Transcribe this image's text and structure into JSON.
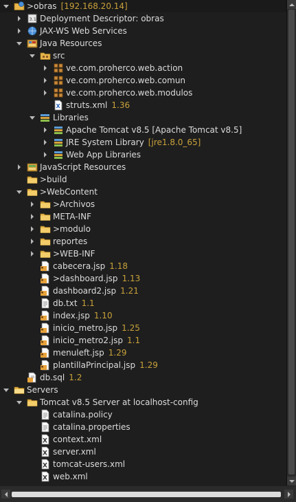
{
  "colors": {
    "background": "#1e1e1e",
    "text": "#dcdcdc",
    "decoration": "#c8a13a"
  },
  "tree": [
    {
      "name": "obras-project",
      "depth": 0,
      "twisty": "expanded",
      "icon": "web-project-icon",
      "label": ">obras",
      "extra": "[192.168.20.14]",
      "extra_kind": "ip",
      "selected": true
    },
    {
      "name": "deployment-descriptor",
      "depth": 1,
      "twisty": "collapsed",
      "icon": "deployment-descriptor-icon",
      "label": "Deployment Descriptor: obras"
    },
    {
      "name": "jax-ws-web-services",
      "depth": 1,
      "twisty": "collapsed",
      "icon": "web-services-icon",
      "label": "JAX-WS Web Services"
    },
    {
      "name": "java-resources",
      "depth": 1,
      "twisty": "expanded",
      "icon": "java-resources-icon",
      "label": "Java Resources"
    },
    {
      "name": "src",
      "depth": 2,
      "twisty": "expanded",
      "icon": "source-folder-icon",
      "label": "src"
    },
    {
      "name": "package-web-action",
      "depth": 3,
      "twisty": "collapsed",
      "icon": "package-icon",
      "label": "ve.com.proherco.web.action"
    },
    {
      "name": "package-web-comun",
      "depth": 3,
      "twisty": "collapsed",
      "icon": "package-icon",
      "label": "ve.com.proherco.web.comun"
    },
    {
      "name": "package-web-modulos",
      "depth": 3,
      "twisty": "collapsed",
      "icon": "package-icon",
      "label": "ve.com.proherco.web.modulos"
    },
    {
      "name": "struts-xml",
      "depth": 3,
      "twisty": "none",
      "icon": "struts-file-icon",
      "label": "struts.xml",
      "extra": "1.36",
      "extra_kind": "ver"
    },
    {
      "name": "libraries",
      "depth": 2,
      "twisty": "expanded",
      "icon": "libraries-icon",
      "label": "Libraries"
    },
    {
      "name": "apache-tomcat-lib",
      "depth": 3,
      "twisty": "collapsed",
      "icon": "library-icon",
      "label": "Apache Tomcat v8.5 [Apache Tomcat v8.5]"
    },
    {
      "name": "jre-system-library",
      "depth": 3,
      "twisty": "collapsed",
      "icon": "library-icon",
      "label": "JRE System Library",
      "extra": "[jre1.8.0_65]",
      "extra_kind": "ver"
    },
    {
      "name": "web-app-libraries",
      "depth": 3,
      "twisty": "collapsed",
      "icon": "library-icon",
      "label": "Web App Libraries"
    },
    {
      "name": "javascript-resources",
      "depth": 1,
      "twisty": "collapsed",
      "icon": "javascript-resources-icon",
      "label": "JavaScript Resources"
    },
    {
      "name": "build-folder",
      "depth": 1,
      "twisty": "none",
      "icon": "folder-icon",
      "label": ">build"
    },
    {
      "name": "webcontent-folder",
      "depth": 1,
      "twisty": "expanded",
      "icon": "folder-icon",
      "label": ">WebContent"
    },
    {
      "name": "archivos-folder",
      "depth": 2,
      "twisty": "collapsed",
      "icon": "folder-icon",
      "label": ">Archivos"
    },
    {
      "name": "meta-inf-folder",
      "depth": 2,
      "twisty": "collapsed",
      "icon": "folder-icon",
      "label": "META-INF"
    },
    {
      "name": "modulo-folder",
      "depth": 2,
      "twisty": "collapsed",
      "icon": "folder-icon",
      "label": ">modulo"
    },
    {
      "name": "reportes-folder",
      "depth": 2,
      "twisty": "collapsed",
      "icon": "folder-icon",
      "label": "reportes"
    },
    {
      "name": "web-inf-folder",
      "depth": 2,
      "twisty": "collapsed",
      "icon": "folder-icon",
      "label": ">WEB-INF"
    },
    {
      "name": "cabecera-jsp",
      "depth": 2,
      "twisty": "none",
      "icon": "jsp-file-icon",
      "label": "cabecera.jsp",
      "extra": "1.18",
      "extra_kind": "ver"
    },
    {
      "name": "dashboard-jsp",
      "depth": 2,
      "twisty": "none",
      "icon": "jsp-file-icon",
      "label": ">dashboard.jsp",
      "extra": "1.13",
      "extra_kind": "ver"
    },
    {
      "name": "dashboard2-jsp",
      "depth": 2,
      "twisty": "none",
      "icon": "jsp-file-icon",
      "label": "dashboard2.jsp",
      "extra": "1.21",
      "extra_kind": "ver"
    },
    {
      "name": "db-txt",
      "depth": 2,
      "twisty": "none",
      "icon": "text-file-icon",
      "label": "db.txt",
      "extra": "1.1",
      "extra_kind": "ver"
    },
    {
      "name": "index-jsp",
      "depth": 2,
      "twisty": "none",
      "icon": "jsp-file-icon",
      "label": "index.jsp",
      "extra": "1.10",
      "extra_kind": "ver"
    },
    {
      "name": "inicio-metro-jsp",
      "depth": 2,
      "twisty": "none",
      "icon": "jsp-file-icon",
      "label": "inicio_metro.jsp",
      "extra": "1.25",
      "extra_kind": "ver"
    },
    {
      "name": "inicio-metro2-jsp",
      "depth": 2,
      "twisty": "none",
      "icon": "jsp-file-icon",
      "label": "inicio_metro2.jsp",
      "extra": "1.1",
      "extra_kind": "ver"
    },
    {
      "name": "menuleft-jsp",
      "depth": 2,
      "twisty": "none",
      "icon": "jsp-file-icon",
      "label": "menuleft.jsp",
      "extra": "1.29",
      "extra_kind": "ver"
    },
    {
      "name": "plantilla-principal-jsp",
      "depth": 2,
      "twisty": "none",
      "icon": "jsp-file-icon",
      "label": "plantillaPrincipal.jsp",
      "extra": "1.29",
      "extra_kind": "ver"
    },
    {
      "name": "db-sql",
      "depth": 1,
      "twisty": "none",
      "icon": "sql-file-icon",
      "label": "db.sql",
      "extra": "1.2",
      "extra_kind": "ver"
    },
    {
      "name": "servers-project",
      "depth": 0,
      "twisty": "expanded",
      "icon": "servers-folder-icon",
      "label": "Servers"
    },
    {
      "name": "tomcat-server-config",
      "depth": 1,
      "twisty": "expanded",
      "icon": "folder-icon",
      "label": "Tomcat v8.5 Server at localhost-config"
    },
    {
      "name": "catalina-policy",
      "depth": 2,
      "twisty": "none",
      "icon": "text-file-icon",
      "label": "catalina.policy"
    },
    {
      "name": "catalina-properties",
      "depth": 2,
      "twisty": "none",
      "icon": "text-file-icon",
      "label": "catalina.properties"
    },
    {
      "name": "context-xml",
      "depth": 2,
      "twisty": "none",
      "icon": "xml-file-icon",
      "label": "context.xml"
    },
    {
      "name": "server-xml",
      "depth": 2,
      "twisty": "none",
      "icon": "xml-file-icon",
      "label": "server.xml"
    },
    {
      "name": "tomcat-users-xml",
      "depth": 2,
      "twisty": "none",
      "icon": "xml-file-icon",
      "label": "tomcat-users.xml"
    },
    {
      "name": "web-xml",
      "depth": 2,
      "twisty": "none",
      "icon": "xml-file-icon",
      "label": "web.xml"
    }
  ]
}
